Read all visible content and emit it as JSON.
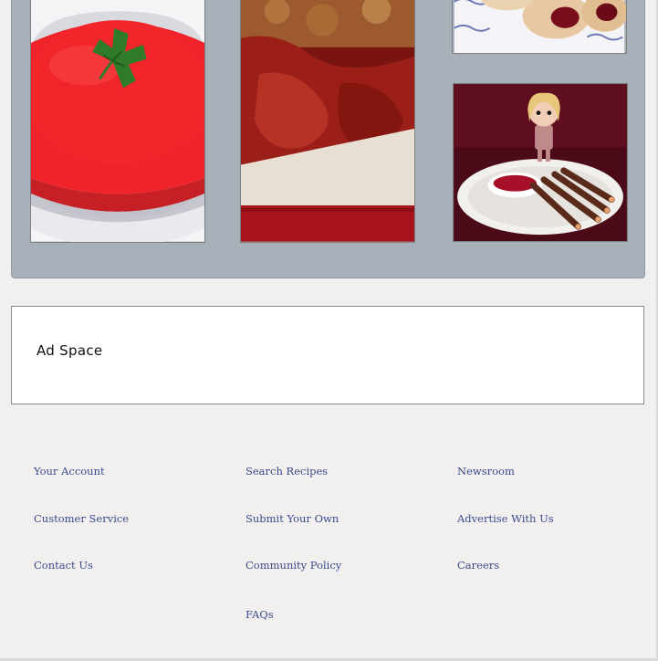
{
  "gallery": {
    "cards": [
      {
        "image": "tomato-sauce-bowl-with-parsley",
        "color": "#e8262b"
      },
      {
        "image": "glazed-meatloaf-on-red-cloth",
        "color": "#8e1d16"
      },
      {
        "image": "jam-tarts-on-blue-plate",
        "color": "#3b4f9e"
      },
      {
        "image": "witch-finger-pretzels-with-sauce-and-figure",
        "color": "#6b1020"
      }
    ]
  },
  "ad": {
    "label": "Ad Space"
  },
  "footer": {
    "col1": [
      "Your Account",
      "Customer Service",
      "Contact Us"
    ],
    "col2": [
      "Search Recipes",
      "Submit Your Own",
      "Community Policy",
      "FAQs"
    ],
    "col3": [
      "Newsroom",
      "Advertise With Us",
      "Careers"
    ]
  },
  "colors": {
    "background": "#f2f0ee",
    "gallery_bg": "#a8b1ba",
    "link": "#3a4a8c"
  }
}
